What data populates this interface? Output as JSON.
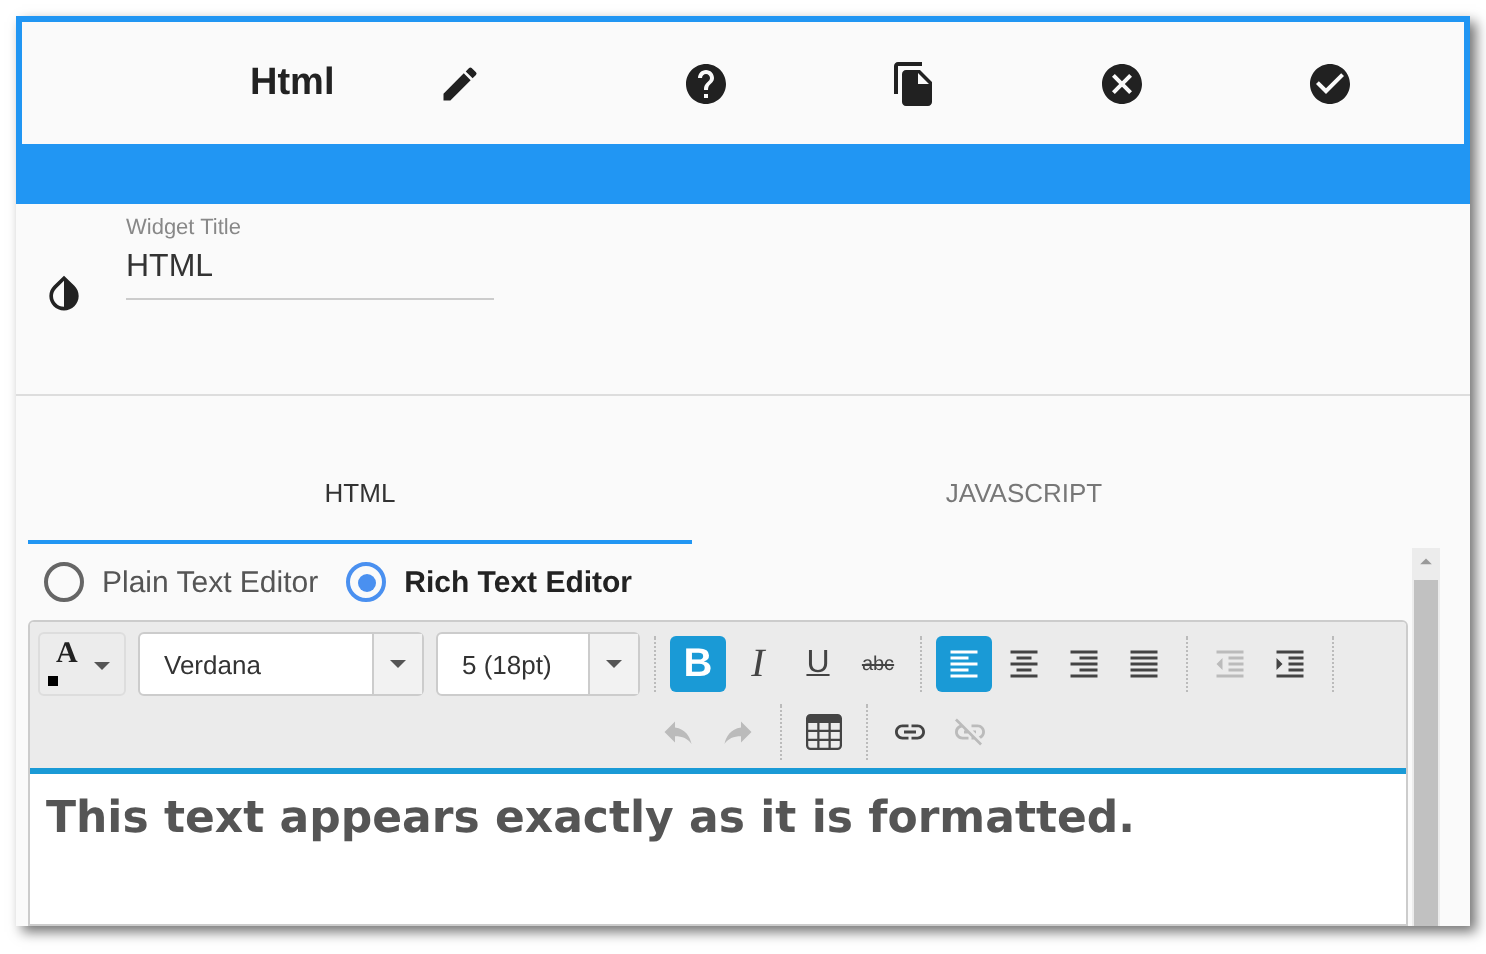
{
  "header": {
    "title": "Html"
  },
  "widget_title": {
    "label": "Widget Title",
    "value": "HTML"
  },
  "tabs": [
    {
      "label": "HTML",
      "selected": true
    },
    {
      "label": "JAVASCRIPT",
      "selected": false
    }
  ],
  "editor_modes": [
    {
      "label": "Plain Text Editor",
      "selected": false
    },
    {
      "label": "Rich Text Editor",
      "selected": true
    }
  ],
  "toolbar": {
    "font_color": {
      "glyph": "A"
    },
    "font": "Verdana",
    "size": "5 (18pt)",
    "format_buttons": [
      {
        "glyph": "B",
        "kind": "bold",
        "selected": true
      },
      {
        "glyph": "I",
        "kind": "italic",
        "selected": false
      },
      {
        "glyph": "U",
        "kind": "underline",
        "selected": false
      },
      {
        "glyph": "abc",
        "kind": "strike",
        "selected": false
      }
    ],
    "align_buttons": [
      {
        "kind": "left",
        "selected": true
      },
      {
        "kind": "center",
        "selected": false
      },
      {
        "kind": "right",
        "selected": false
      },
      {
        "kind": "justify",
        "selected": false
      }
    ],
    "indent_buttons": [
      {
        "kind": "outdent",
        "disabled": true
      },
      {
        "kind": "indent",
        "disabled": false
      }
    ],
    "history_buttons": [
      {
        "kind": "undo",
        "disabled": true
      },
      {
        "kind": "redo",
        "disabled": true
      }
    ],
    "table_button": {
      "kind": "table"
    },
    "link_buttons": [
      {
        "kind": "link",
        "disabled": false
      },
      {
        "kind": "unlink",
        "disabled": true
      }
    ]
  },
  "content": "This text appears exactly as it is formatted."
}
